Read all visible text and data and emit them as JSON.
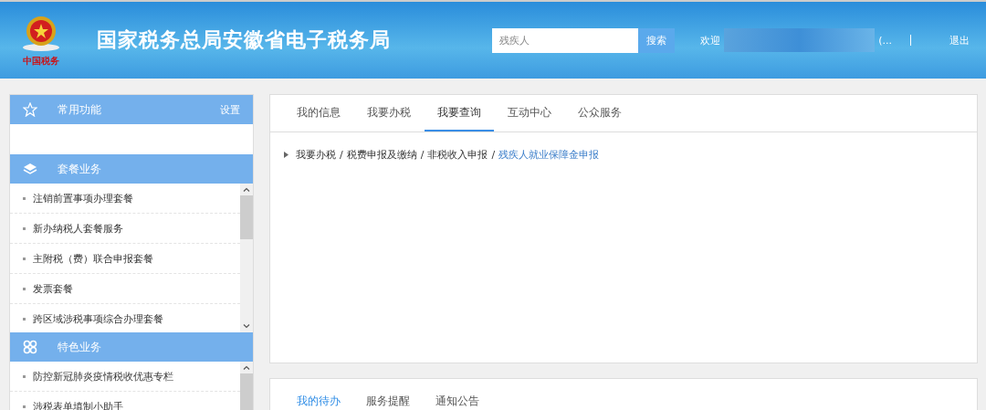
{
  "header": {
    "title": "国家税务总局安徽省电子税务局",
    "logo_caption": "中国税务",
    "search": {
      "value": "残疾人",
      "button": "搜索"
    },
    "welcome": "欢迎",
    "user_suffix": "(...",
    "logout": "退出"
  },
  "sidebar": {
    "favorites": {
      "title": "常用功能",
      "action": "设置"
    },
    "sections": [
      {
        "title": "套餐业务",
        "items": [
          "注销前置事项办理套餐",
          "新办纳税人套餐服务",
          "主附税（费）联合申报套餐",
          "发票套餐",
          "跨区域涉税事项综合办理套餐"
        ]
      },
      {
        "title": "特色业务",
        "items": [
          "防控新冠肺炎疫情税收优惠专栏",
          "涉税表单填制小助手"
        ]
      }
    ]
  },
  "main_tabs": [
    {
      "label": "我的信息",
      "selected": false
    },
    {
      "label": "我要办税",
      "selected": false
    },
    {
      "label": "我要查询",
      "selected": true
    },
    {
      "label": "互动中心",
      "selected": false
    },
    {
      "label": "公众服务",
      "selected": false
    }
  ],
  "breadcrumb_separator": "/",
  "breadcrumb": [
    "我要办税",
    "税费申报及缴纳",
    "非税收入申报",
    "残疾人就业保障金申报"
  ],
  "bottom_tabs": [
    {
      "label": "我的待办",
      "selected": true
    },
    {
      "label": "服务提醒",
      "selected": false
    },
    {
      "label": "通知公告",
      "selected": false
    }
  ]
}
